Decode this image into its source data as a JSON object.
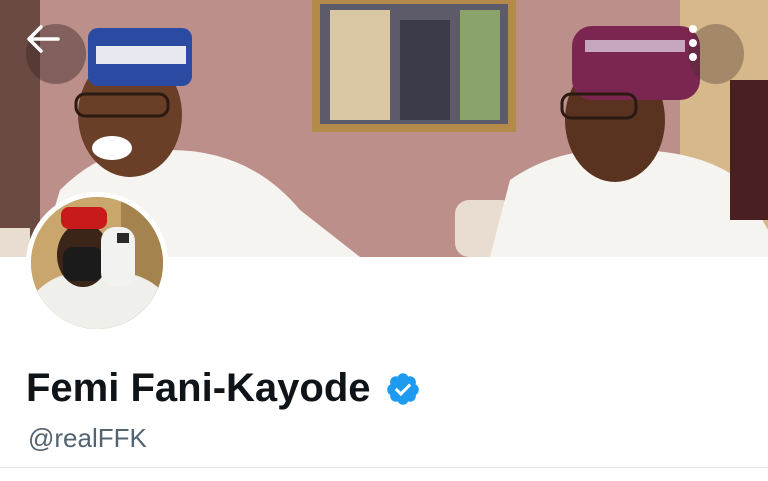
{
  "header": {
    "back_icon": "arrow-left-icon",
    "menu_icon": "more-vertical-icon"
  },
  "profile": {
    "display_name": "Femi Fani-Kayode",
    "handle": "@realFFK",
    "verified": true,
    "verified_icon": "verified-badge-icon",
    "verified_color": "#1d9bf0"
  },
  "colors": {
    "name_text": "#0f1419",
    "handle_text": "#536471",
    "divider": "#e1e6ea"
  }
}
